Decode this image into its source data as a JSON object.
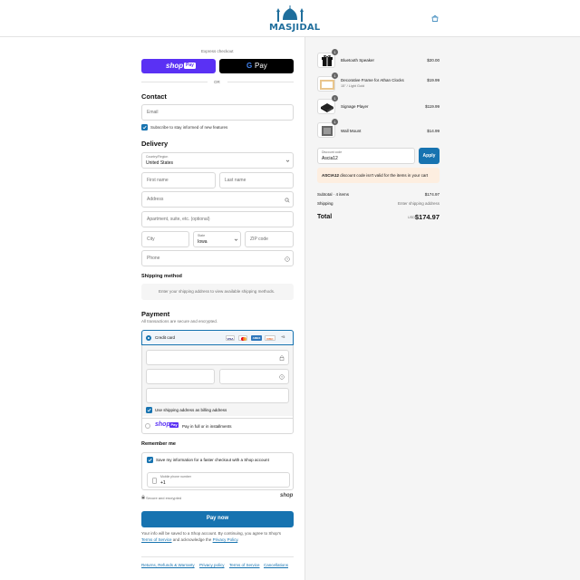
{
  "header": {
    "logo_text": "MASJIDAL",
    "cart_icon": "shopping-bag-icon"
  },
  "express": {
    "label": "Express checkout",
    "shop_pay": "shop",
    "shop_pay_badge": "Pay",
    "google_pay": "Pay",
    "or": "OR"
  },
  "contact": {
    "title": "Contact",
    "email_placeholder": "Email",
    "subscribe_label": "Subscribe to stay informed of new features"
  },
  "delivery": {
    "title": "Delivery",
    "country_label": "Country/Region",
    "country_value": "United States",
    "first_name": "First name",
    "last_name": "Last name",
    "address": "Address",
    "apartment": "Apartment, suite, etc. (optional)",
    "city": "City",
    "state_label": "State",
    "state_value": "Iowa",
    "zip": "ZIP code",
    "phone": "Phone"
  },
  "shipping": {
    "title": "Shipping method",
    "message": "Enter your shipping address to view available shipping methods."
  },
  "payment": {
    "title": "Payment",
    "subtitle": "All transactions are secure and encrypted.",
    "credit_card": "Credit card",
    "cards": [
      "VISA",
      "MC",
      "AMEX",
      "DISC"
    ],
    "more_cards": "+5",
    "billing_label": "Use shipping address as billing address",
    "shop_pay_logo": "shop",
    "shop_pay_badge": "Pay",
    "shop_pay_label": "Pay in full or in installments"
  },
  "remember": {
    "title": "Remember me",
    "save_label": "Save my information for a faster checkout with a Shop account",
    "mobile_label": "Mobile phone number",
    "mobile_value": "+1",
    "secure_label": "Secure and encrypted",
    "shop_logo": "shop"
  },
  "pay_button": "Pay now",
  "legal": {
    "line1": "Your info will be saved to a Shop account. By continuing, you agree to Shop's",
    "terms": "Terms of Service",
    "and": "and acknowledge the",
    "privacy": "Privacy Policy",
    "end": "."
  },
  "footer_links": [
    "Returns, Refunds & Warranty",
    "Privacy policy",
    "Terms of Service",
    "Cancellations"
  ],
  "cart": {
    "items": [
      {
        "name": "Bluetooth Speaker",
        "variant": "",
        "price": "$20.00",
        "qty": "1"
      },
      {
        "name": "Decorative Frame for Athan Clocks",
        "variant": "15\" / Light Gold",
        "price": "$19.99",
        "qty": "1"
      },
      {
        "name": "Signage Player",
        "variant": "",
        "price": "$119.99",
        "qty": "1"
      },
      {
        "name": "Wall Mount",
        "variant": "",
        "price": "$14.99",
        "qty": "1"
      }
    ],
    "discount_label": "Discount code",
    "discount_value": "Ascia12",
    "apply": "Apply",
    "error_code": "ASCIA12",
    "error_text": " discount code isn't valid for the items in your cart",
    "subtotal_label": "Subtotal · 4 items",
    "subtotal_value": "$174.97",
    "shipping_label": "Shipping",
    "shipping_value": "Enter shipping address",
    "total_label": "Total",
    "currency": "USD",
    "total_value": "$174.97"
  },
  "colors": {
    "accent": "#1773b0",
    "shop_purple": "#5a31f4",
    "error_bg": "#fdeee0"
  }
}
